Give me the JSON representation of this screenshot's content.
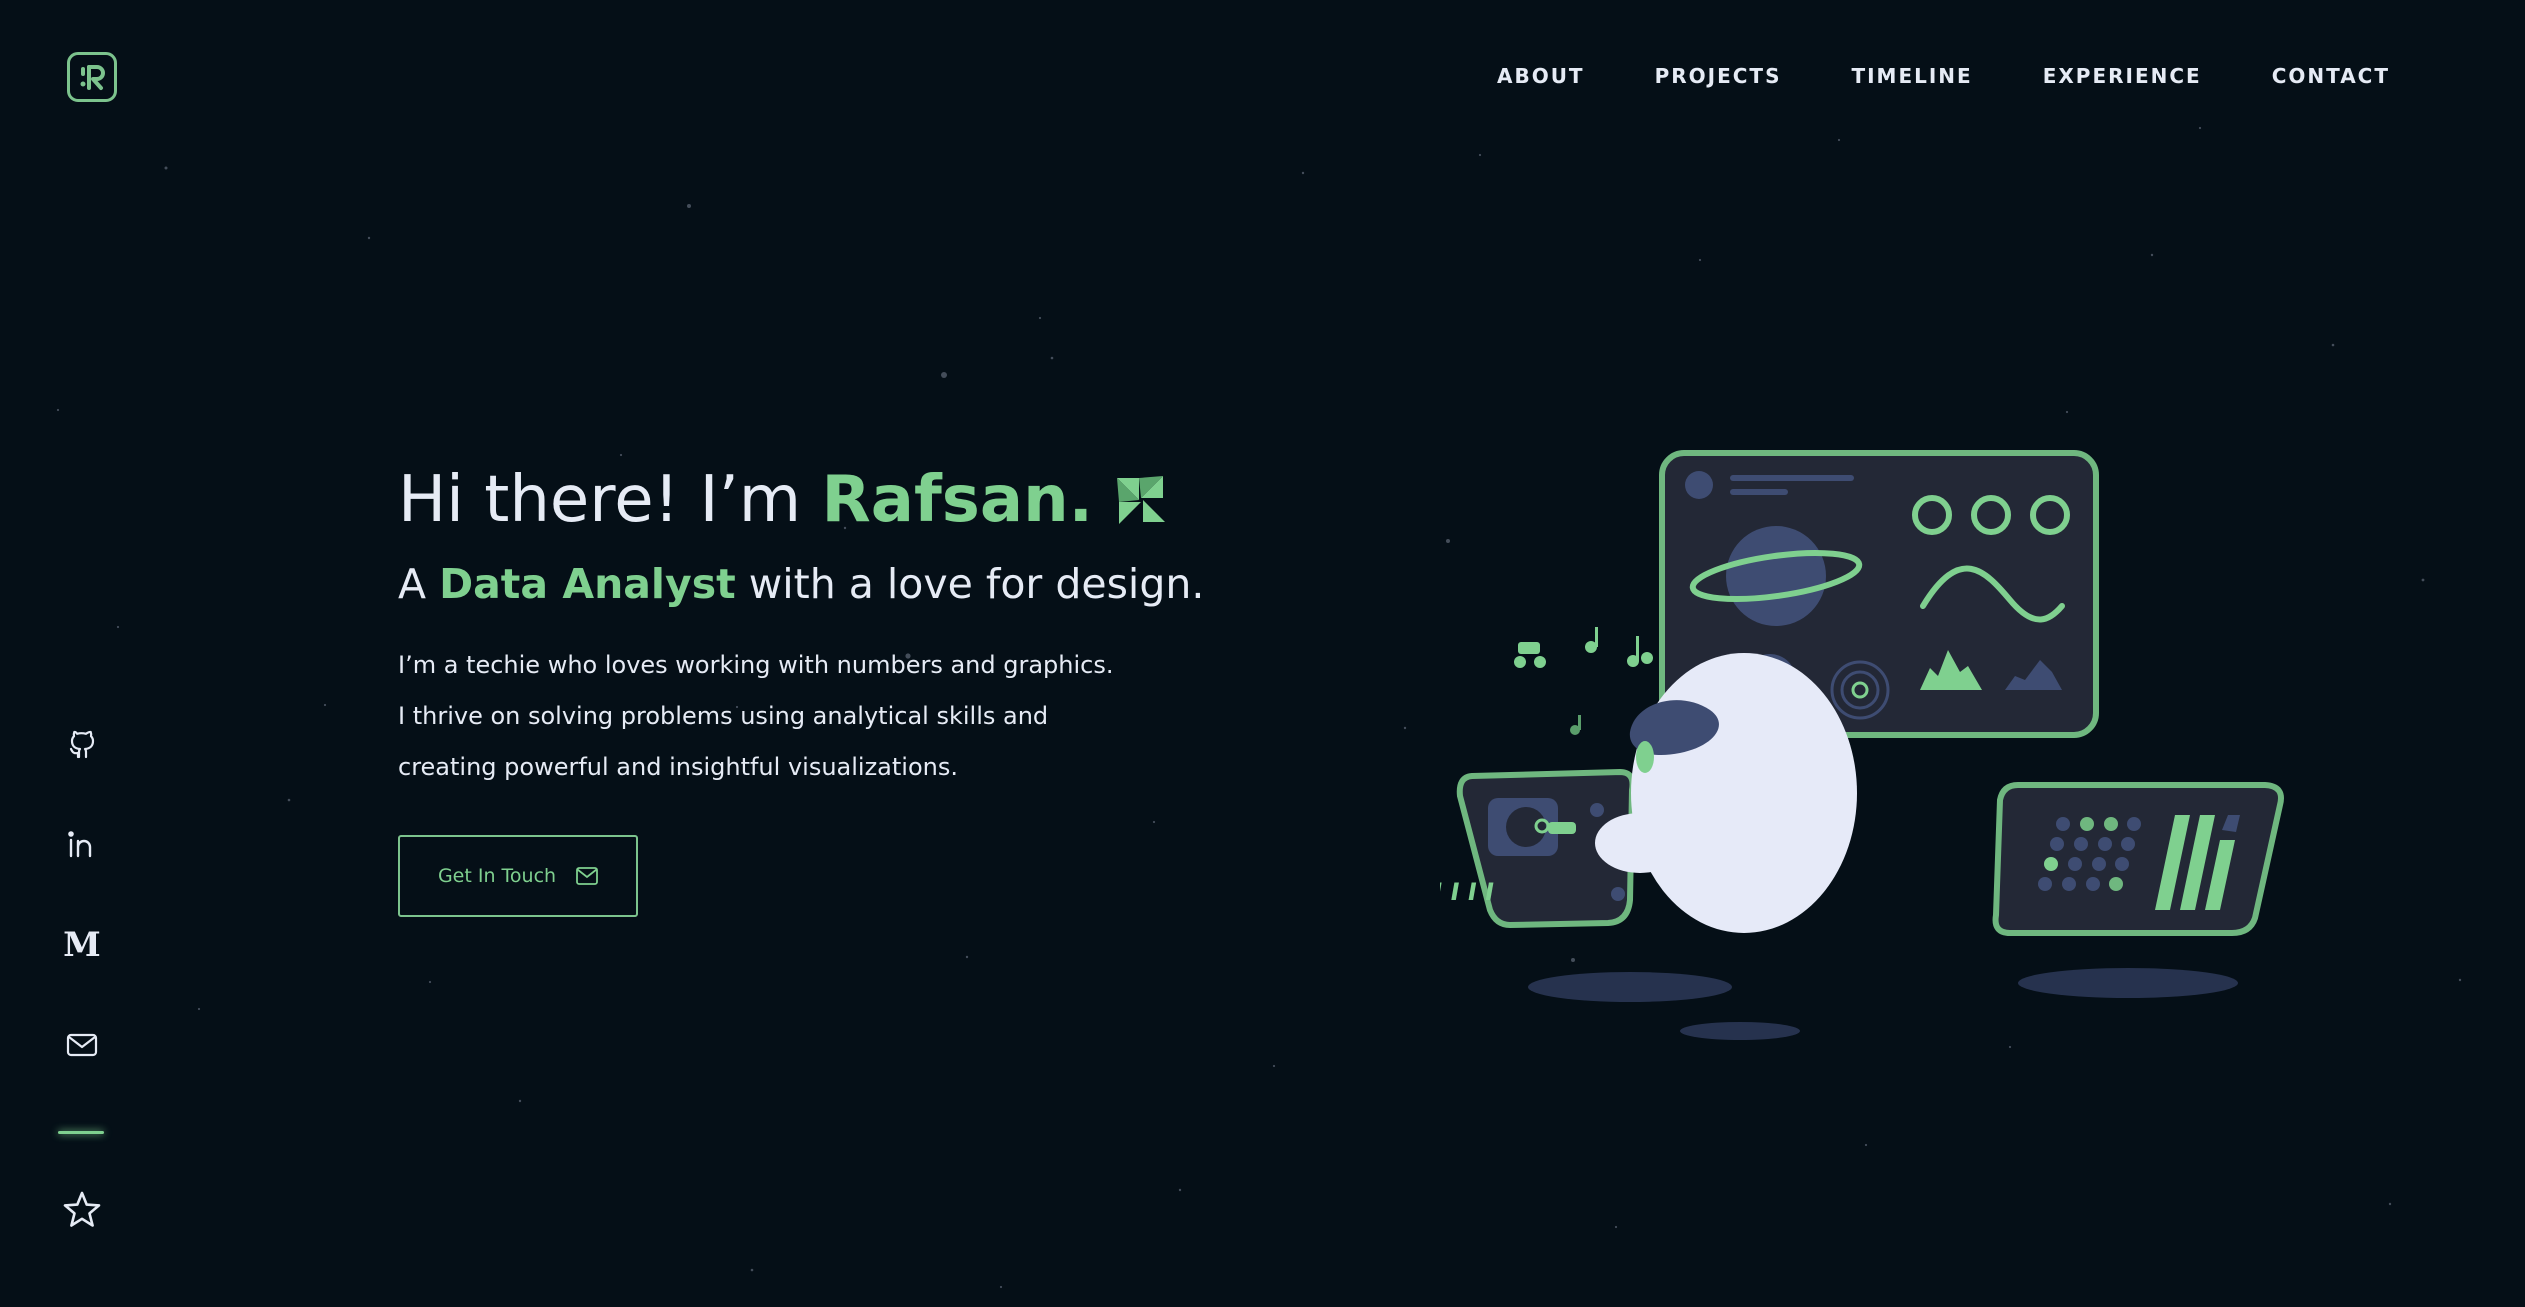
{
  "colors": {
    "background": "#050f17",
    "accent": "#7fd08f",
    "text": "#e6ebf5",
    "panel": "#232836",
    "slate": "#3e4c72",
    "robot": "#e6eaf8"
  },
  "logo": {
    "icon": "logo-monogram-icon"
  },
  "nav": {
    "items": [
      {
        "label": "ABOUT"
      },
      {
        "label": "PROJECTS"
      },
      {
        "label": "TIMELINE"
      },
      {
        "label": "EXPERIENCE"
      },
      {
        "label": "CONTACT"
      }
    ]
  },
  "hero": {
    "greeting_prefix": "Hi there! I’m ",
    "name": "Rafsan.",
    "subtitle_prefix": "A ",
    "role": "Data Analyst",
    "subtitle_suffix": " with a love for design.",
    "description_lines": [
      "I’m a techie who loves working with numbers and graphics.",
      "I thrive on solving problems using analytical skills and",
      "creating powerful and insightful visualizations."
    ],
    "cta_label": "Get In Touch"
  },
  "social_icons": [
    "github-icon",
    "linkedin-icon",
    "medium-icon",
    "mail-icon",
    "star-icon"
  ]
}
